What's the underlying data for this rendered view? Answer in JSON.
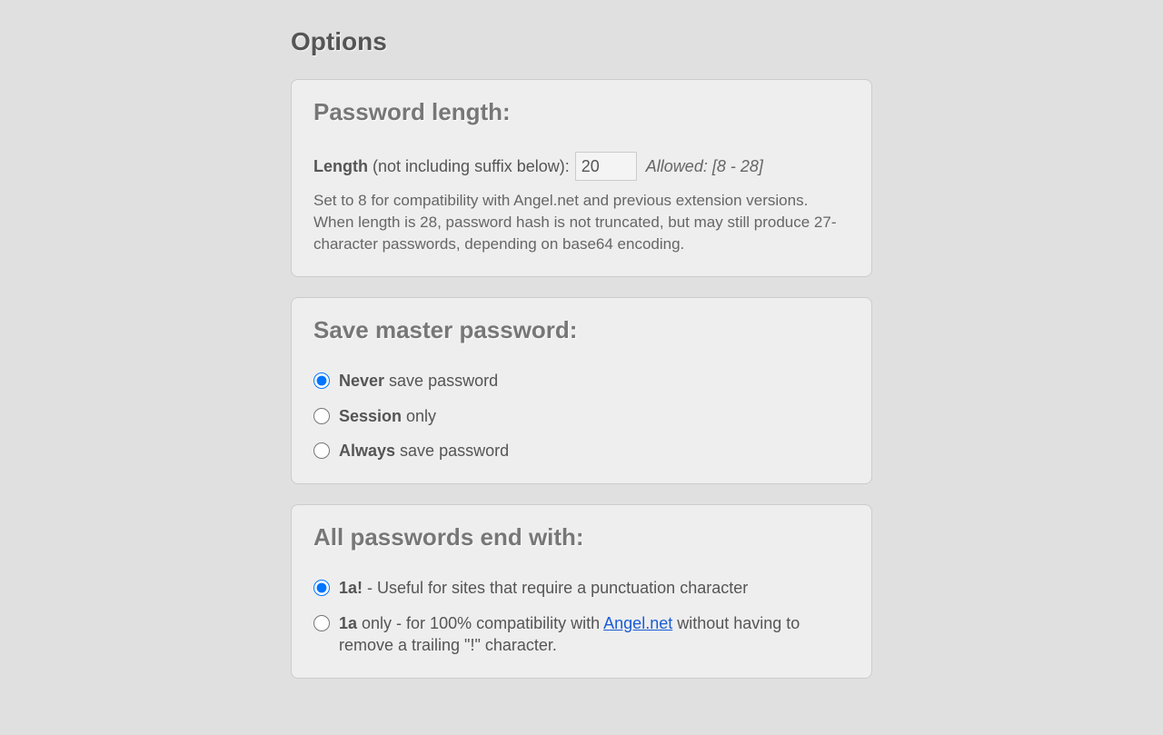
{
  "page_title": "Options",
  "password_length": {
    "heading": "Password length:",
    "label_strong": "Length",
    "label_rest": " (not including suffix below): ",
    "value": "20",
    "allowed": "Allowed: [8 - 28]",
    "description": "Set to 8 for compatibility with Angel.net and previous extension versions. When length is 28, password hash is not truncated, but may still produce 27-character passwords, depending on base64 encoding."
  },
  "save_master": {
    "heading": "Save master password:",
    "options": [
      {
        "bold": "Never",
        "rest": " save password",
        "checked": true
      },
      {
        "bold": "Session",
        "rest": " only",
        "checked": false
      },
      {
        "bold": "Always",
        "rest": " save password",
        "checked": false
      }
    ]
  },
  "suffix": {
    "heading": "All passwords end with:",
    "options": [
      {
        "bold": "1a!",
        "rest": " - Useful for sites that require a punctuation character",
        "checked": true
      },
      {
        "bold": "1a",
        "rest_pre": " only - for 100% compatibility with ",
        "link_text": "Angel.net",
        "rest_post": " without having to remove a trailing \"!\" character.",
        "checked": false
      }
    ]
  }
}
